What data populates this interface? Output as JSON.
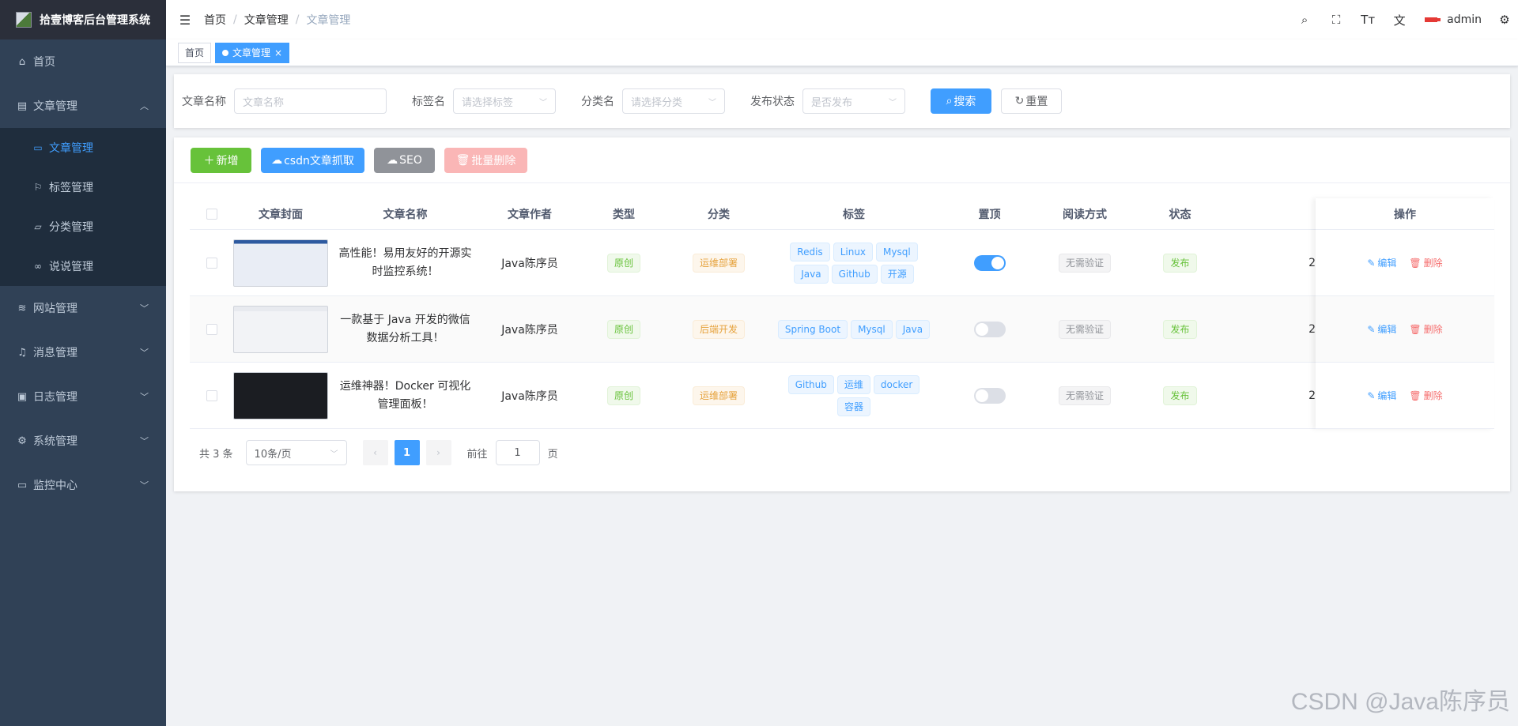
{
  "sidebar": {
    "brand": "拾壹博客后台管理系统",
    "items": [
      {
        "label": "首页"
      },
      {
        "label": "文章管理"
      },
      {
        "label": "文章管理"
      },
      {
        "label": "标签管理"
      },
      {
        "label": "分类管理"
      },
      {
        "label": "说说管理"
      },
      {
        "label": "网站管理"
      },
      {
        "label": "消息管理"
      },
      {
        "label": "日志管理"
      },
      {
        "label": "系统管理"
      },
      {
        "label": "监控中心"
      }
    ]
  },
  "navbar": {
    "breadcrumb": [
      "首页",
      "文章管理",
      "文章管理"
    ],
    "user": "admin"
  },
  "tags_view": {
    "tabs": [
      {
        "label": "首页"
      },
      {
        "label": "文章管理"
      }
    ]
  },
  "search": {
    "title_label": "文章名称",
    "title_placeholder": "文章名称",
    "tag_label": "标签名",
    "tag_placeholder": "请选择标签",
    "category_label": "分类名",
    "category_placeholder": "请选择分类",
    "status_label": "发布状态",
    "status_placeholder": "是否发布",
    "search_button": "搜索",
    "reset_button": "重置"
  },
  "toolbar": {
    "add": "新增",
    "csdn": "csdn文章抓取",
    "seo": "SEO",
    "batch_delete": "批量删除"
  },
  "table": {
    "headers": [
      "文章封面",
      "文章名称",
      "文章作者",
      "类型",
      "分类",
      "标签",
      "置顶",
      "阅读方式",
      "状态",
      "操作"
    ],
    "rows": [
      {
        "title": "高性能！易用友好的开源实时监控系统！",
        "author": "Java陈序员",
        "type": "原创",
        "category": "运维部署",
        "tags": [
          "Redis",
          "Linux",
          "Mysql",
          "Java",
          "Github",
          "开源"
        ],
        "top": true,
        "read_mode": "无需验证",
        "status": "发布",
        "overflow": "2",
        "edit": "编辑",
        "delete": "删除"
      },
      {
        "title": "一款基于 Java 开发的微信数据分析工具！",
        "author": "Java陈序员",
        "type": "原创",
        "category": "后端开发",
        "tags": [
          "Spring Boot",
          "Mysql",
          "Java"
        ],
        "top": false,
        "read_mode": "无需验证",
        "status": "发布",
        "overflow": "2",
        "edit": "编辑",
        "delete": "删除"
      },
      {
        "title": "运维神器！Docker 可视化管理面板！",
        "author": "Java陈序员",
        "type": "原创",
        "category": "运维部署",
        "tags": [
          "Github",
          "运维",
          "docker",
          "容器"
        ],
        "top": false,
        "read_mode": "无需验证",
        "status": "发布",
        "overflow": "2",
        "edit": "编辑",
        "delete": "删除"
      }
    ]
  },
  "pagination": {
    "total": "共 3 条",
    "page_size": "10条/页",
    "current": "1",
    "goto_label": "前往",
    "goto_value": "1",
    "page_suffix": "页"
  },
  "watermark": "CSDN @Java陈序员"
}
